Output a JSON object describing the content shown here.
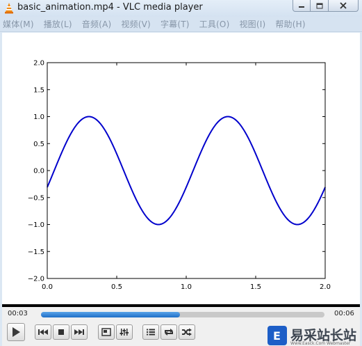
{
  "window": {
    "title": "basic_animation.mp4 - VLC media player"
  },
  "menu": [
    {
      "label": "媒体(M)"
    },
    {
      "label": "播放(L)"
    },
    {
      "label": "音频(A)"
    },
    {
      "label": "视频(V)"
    },
    {
      "label": "字幕(T)"
    },
    {
      "label": "工具(O)"
    },
    {
      "label": "视图(I)"
    },
    {
      "label": "帮助(H)"
    }
  ],
  "playback": {
    "elapsed": "00:03",
    "total": "00:06",
    "progress_fraction": 0.49
  },
  "controls": [
    {
      "name": "play-button",
      "icon": "play-icon"
    },
    {
      "name": "previous-button",
      "icon": "skip-back-icon"
    },
    {
      "name": "stop-button",
      "icon": "stop-icon"
    },
    {
      "name": "next-button",
      "icon": "skip-forward-icon"
    },
    {
      "name": "fullscreen-button",
      "icon": "fullscreen-icon"
    },
    {
      "name": "extended-settings-button",
      "icon": "equalizer-icon"
    },
    {
      "name": "playlist-button",
      "icon": "playlist-icon"
    },
    {
      "name": "loop-button",
      "icon": "loop-icon"
    },
    {
      "name": "shuffle-button",
      "icon": "shuffle-icon"
    }
  ],
  "watermark": {
    "text": "易采站长站",
    "subtext": "Www.Easck.Com Webmaster"
  },
  "colors": {
    "accent": "#2f7fd3",
    "curve": "#0000cc"
  },
  "chart_data": {
    "type": "line",
    "title": "",
    "xlabel": "",
    "ylabel": "",
    "xlim": [
      0.0,
      2.0
    ],
    "ylim": [
      -2.0,
      2.0
    ],
    "xticks": [
      "0.0",
      "0.5",
      "1.0",
      "1.5",
      "2.0"
    ],
    "yticks": [
      "2.0",
      "1.5",
      "1.0",
      "0.5",
      "0.0",
      "−0.5",
      "−1.0",
      "−1.5",
      "−2.0"
    ],
    "grid": false,
    "series": [
      {
        "function": "sin(2*pi*(x - 0.05))",
        "x": [
          0.0,
          0.1,
          0.2,
          0.3,
          0.4,
          0.5,
          0.6,
          0.7,
          0.8,
          0.9,
          1.0,
          1.1,
          1.2,
          1.3,
          1.4,
          1.5,
          1.6,
          1.7,
          1.8,
          1.9,
          2.0
        ],
        "y": [
          -0.31,
          0.31,
          0.81,
          1.0,
          0.81,
          0.31,
          -0.31,
          -0.81,
          -1.0,
          -0.81,
          -0.31,
          0.31,
          0.81,
          1.0,
          0.81,
          0.31,
          -0.31,
          -0.81,
          -1.0,
          -0.81,
          -0.31
        ],
        "color": "#0000cc"
      }
    ]
  }
}
